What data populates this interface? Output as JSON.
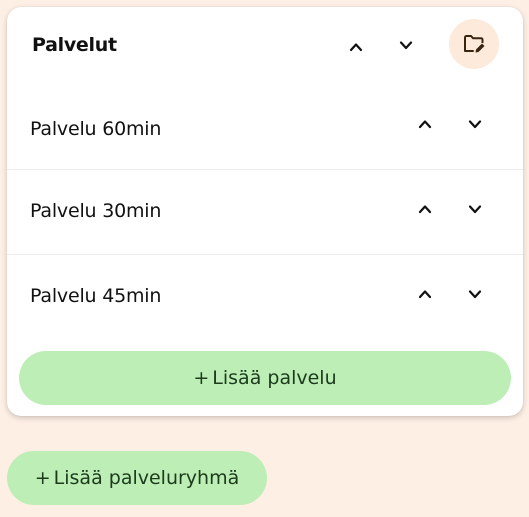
{
  "group": {
    "title": "Palvelut",
    "edit_icon": "folder-edit-icon",
    "services": [
      {
        "name": "Palvelu 60min"
      },
      {
        "name": "Palvelu 30min"
      },
      {
        "name": "Palvelu 45min"
      }
    ],
    "add_service_plus": "+",
    "add_service_label": "Lisää palvelu"
  },
  "add_group_plus": "+",
  "add_group_label": "Lisää palveluryhmä",
  "colors": {
    "background": "#fdefe4",
    "card": "#ffffff",
    "button_green": "#bdeeb6",
    "edit_button_bg": "#fdeadb"
  }
}
